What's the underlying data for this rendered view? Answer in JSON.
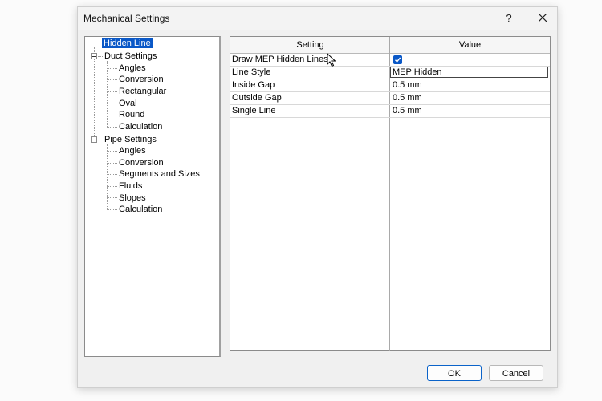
{
  "window": {
    "title": "Mechanical Settings",
    "help_label": "?"
  },
  "tree": {
    "nodes": [
      {
        "label": "Hidden Line",
        "selected": true
      },
      {
        "label": "Duct Settings"
      },
      {
        "label": "Angles"
      },
      {
        "label": "Conversion"
      },
      {
        "label": "Rectangular"
      },
      {
        "label": "Oval"
      },
      {
        "label": "Round"
      },
      {
        "label": "Calculation"
      },
      {
        "label": "Pipe Settings"
      },
      {
        "label": "Angles"
      },
      {
        "label": "Conversion"
      },
      {
        "label": "Segments and Sizes"
      },
      {
        "label": "Fluids"
      },
      {
        "label": "Slopes"
      },
      {
        "label": "Calculation"
      }
    ]
  },
  "grid": {
    "headers": [
      "Setting",
      "Value"
    ],
    "rows": [
      {
        "setting": "Draw MEP Hidden Lines",
        "value": "",
        "checked": true
      },
      {
        "setting": "Line Style",
        "value": "MEP Hidden"
      },
      {
        "setting": "Inside Gap",
        "value": "0.5 mm"
      },
      {
        "setting": "Outside Gap",
        "value": "0.5 mm"
      },
      {
        "setting": "Single Line",
        "value": "0.5 mm"
      }
    ]
  },
  "buttons": {
    "ok": "OK",
    "cancel": "Cancel"
  },
  "colors": {
    "selection": "#0a58c7",
    "dialog_bg": "#f0f0f0"
  }
}
